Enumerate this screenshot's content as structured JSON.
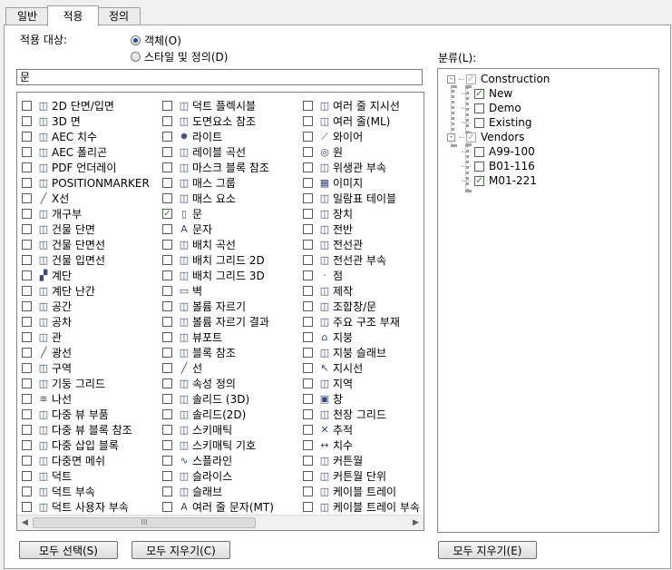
{
  "tabs": [
    {
      "label": "일반",
      "active": false
    },
    {
      "label": "적용",
      "active": true
    },
    {
      "label": "정의",
      "active": false
    }
  ],
  "apply_to": {
    "label": "적용 대상:",
    "options": [
      {
        "label": "객체(O)",
        "selected": true
      },
      {
        "label": "스타일 및 정의(D)",
        "selected": false
      }
    ]
  },
  "filter": {
    "value": "문"
  },
  "category_label": "분류(L):",
  "object_list": {
    "columns": [
      [
        {
          "label": "2D 단면/입면",
          "checked": false,
          "icon": "section-elevation-icon"
        },
        {
          "label": "3D 면",
          "checked": false,
          "icon": "3d-face-icon"
        },
        {
          "label": "AEC 치수",
          "checked": false,
          "icon": "aec-dimension-icon"
        },
        {
          "label": "AEC 폴리곤",
          "checked": false,
          "icon": "aec-polygon-icon"
        },
        {
          "label": "PDF 언더레이",
          "checked": false,
          "icon": "pdf-underlay-icon"
        },
        {
          "label": "POSITIONMARKER",
          "checked": false,
          "icon": "position-marker-icon"
        },
        {
          "label": "X선",
          "checked": false,
          "icon": "xline-icon"
        },
        {
          "label": "개구부",
          "checked": false,
          "icon": "opening-icon"
        },
        {
          "label": "건물 단면",
          "checked": false,
          "icon": "building-section-icon"
        },
        {
          "label": "건물 단면선",
          "checked": false,
          "icon": "building-section-line-icon"
        },
        {
          "label": "건물 입면선",
          "checked": false,
          "icon": "building-elevation-line-icon"
        },
        {
          "label": "계단",
          "checked": false,
          "icon": "stair-icon"
        },
        {
          "label": "계단 난간",
          "checked": false,
          "icon": "railing-icon"
        },
        {
          "label": "공간",
          "checked": false,
          "icon": "space-icon"
        },
        {
          "label": "공차",
          "checked": false,
          "icon": "tolerance-icon"
        },
        {
          "label": "관",
          "checked": false,
          "icon": "pipe-icon"
        },
        {
          "label": "광선",
          "checked": false,
          "icon": "ray-icon"
        },
        {
          "label": "구역",
          "checked": false,
          "icon": "zone-icon"
        },
        {
          "label": "기둥 그리드",
          "checked": false,
          "icon": "column-grid-icon"
        },
        {
          "label": "나선",
          "checked": false,
          "icon": "helix-icon"
        },
        {
          "label": "다중 뷰 부품",
          "checked": false,
          "icon": "multi-view-part-icon"
        },
        {
          "label": "다중 뷰 블록 참조",
          "checked": false,
          "icon": "multi-view-block-ref-icon"
        },
        {
          "label": "다중 삽입 블록",
          "checked": false,
          "icon": "minsert-block-icon"
        },
        {
          "label": "다중면 메쉬",
          "checked": false,
          "icon": "polyface-mesh-icon"
        },
        {
          "label": "덕트",
          "checked": false,
          "icon": "duct-icon"
        },
        {
          "label": "덕트 부속",
          "checked": false,
          "icon": "duct-fitting-icon"
        },
        {
          "label": "덕트 사용자 부속",
          "checked": false,
          "icon": "duct-custom-fitting-icon"
        }
      ],
      [
        {
          "label": "덕트 플렉시블",
          "checked": false,
          "icon": "duct-flex-icon"
        },
        {
          "label": "도면요소 참조",
          "checked": false,
          "icon": "element-ref-icon"
        },
        {
          "label": "라이트",
          "checked": false,
          "icon": "light-icon"
        },
        {
          "label": "레이블 곡선",
          "checked": false,
          "icon": "label-curve-icon"
        },
        {
          "label": "마스크 블록 참조",
          "checked": false,
          "icon": "mask-block-ref-icon"
        },
        {
          "label": "매스 그룹",
          "checked": false,
          "icon": "mass-group-icon"
        },
        {
          "label": "매스 요소",
          "checked": false,
          "icon": "mass-element-icon"
        },
        {
          "label": "문",
          "checked": true,
          "icon": "door-icon"
        },
        {
          "label": "문자",
          "checked": false,
          "icon": "text-icon"
        },
        {
          "label": "배치 곡선",
          "checked": false,
          "icon": "layout-curve-icon"
        },
        {
          "label": "배치 그리드 2D",
          "checked": false,
          "icon": "layout-grid-2d-icon"
        },
        {
          "label": "배치 그리드 3D",
          "checked": false,
          "icon": "layout-grid-3d-icon"
        },
        {
          "label": "벽",
          "checked": false,
          "icon": "wall-icon"
        },
        {
          "label": "볼륨 자르기",
          "checked": false,
          "icon": "volume-clip-icon"
        },
        {
          "label": "볼륨 자르기 결과",
          "checked": false,
          "icon": "volume-clip-result-icon"
        },
        {
          "label": "뷰포트",
          "checked": false,
          "icon": "viewport-icon"
        },
        {
          "label": "블록 참조",
          "checked": false,
          "icon": "block-ref-icon"
        },
        {
          "label": "선",
          "checked": false,
          "icon": "line-icon"
        },
        {
          "label": "속성 정의",
          "checked": false,
          "icon": "attribute-def-icon"
        },
        {
          "label": "솔리드 (3D)",
          "checked": false,
          "icon": "solid-3d-icon"
        },
        {
          "label": "솔리드(2D)",
          "checked": false,
          "icon": "solid-2d-icon"
        },
        {
          "label": "스키매틱",
          "checked": false,
          "icon": "schematic-icon"
        },
        {
          "label": "스키매틱 기호",
          "checked": false,
          "icon": "schematic-symbol-icon"
        },
        {
          "label": "스플라인",
          "checked": false,
          "icon": "spline-icon"
        },
        {
          "label": "슬라이스",
          "checked": false,
          "icon": "slice-icon"
        },
        {
          "label": "슬래브",
          "checked": false,
          "icon": "slab-icon"
        },
        {
          "label": "여러 줄 문자(MT)",
          "checked": false,
          "icon": "mtext-icon"
        }
      ],
      [
        {
          "label": "여러 줄 지시선",
          "checked": false,
          "icon": "multileader-icon"
        },
        {
          "label": "여러 줄(ML)",
          "checked": false,
          "icon": "mline-icon"
        },
        {
          "label": "와이어",
          "checked": false,
          "icon": "wire-icon"
        },
        {
          "label": "원",
          "checked": false,
          "icon": "circle-icon"
        },
        {
          "label": "위생관 부속",
          "checked": false,
          "icon": "plumbing-fitting-icon"
        },
        {
          "label": "이미지",
          "checked": false,
          "icon": "image-icon"
        },
        {
          "label": "일람표 테이블",
          "checked": false,
          "icon": "schedule-table-icon"
        },
        {
          "label": "장치",
          "checked": false,
          "icon": "device-icon"
        },
        {
          "label": "전반",
          "checked": false,
          "icon": "panel-icon"
        },
        {
          "label": "전선관",
          "checked": false,
          "icon": "conduit-icon"
        },
        {
          "label": "전선관 부속",
          "checked": false,
          "icon": "conduit-fitting-icon"
        },
        {
          "label": "점",
          "checked": false,
          "icon": "point-icon"
        },
        {
          "label": "제작",
          "checked": false,
          "icon": "fabrication-icon"
        },
        {
          "label": "조합창/문",
          "checked": false,
          "icon": "door-window-assembly-icon"
        },
        {
          "label": "주요 구조 부재",
          "checked": false,
          "icon": "structural-member-icon"
        },
        {
          "label": "지붕",
          "checked": false,
          "icon": "roof-icon"
        },
        {
          "label": "지붕 슬래브",
          "checked": false,
          "icon": "roof-slab-icon"
        },
        {
          "label": "지시선",
          "checked": false,
          "icon": "leader-icon"
        },
        {
          "label": "지역",
          "checked": false,
          "icon": "region-icon"
        },
        {
          "label": "창",
          "checked": false,
          "icon": "window-icon"
        },
        {
          "label": "천장 그리드",
          "checked": false,
          "icon": "ceiling-grid-icon"
        },
        {
          "label": "추적",
          "checked": false,
          "icon": "trace-icon"
        },
        {
          "label": "치수",
          "checked": false,
          "icon": "dimension-icon"
        },
        {
          "label": "커튼월",
          "checked": false,
          "icon": "curtain-wall-icon"
        },
        {
          "label": "커튼월 단위",
          "checked": false,
          "icon": "curtain-wall-unit-icon"
        },
        {
          "label": "케이블 트레이",
          "checked": false,
          "icon": "cable-tray-icon"
        },
        {
          "label": "케이블 트레이 부속",
          "checked": false,
          "icon": "cable-tray-fitting-icon"
        }
      ]
    ],
    "scroll_thumb_grip": "III"
  },
  "tree": {
    "nodes": [
      {
        "label": "Construction",
        "level": 0,
        "expander": "-",
        "checked": true,
        "grey": true
      },
      {
        "label": "New",
        "level": 1,
        "checked": true,
        "grey": false
      },
      {
        "label": "Demo",
        "level": 1,
        "checked": false,
        "grey": false
      },
      {
        "label": "Existing",
        "level": 1,
        "checked": false,
        "grey": false
      },
      {
        "label": "Vendors",
        "level": 0,
        "expander": "-",
        "checked": true,
        "grey": true
      },
      {
        "label": "A99-100",
        "level": 1,
        "checked": false,
        "grey": false
      },
      {
        "label": "B01-116",
        "level": 1,
        "checked": false,
        "grey": false
      },
      {
        "label": "M01-221",
        "level": 1,
        "checked": true,
        "grey": false
      }
    ]
  },
  "buttons": {
    "select_all": "모두 선택(S)",
    "clear_all": "모두 지우기(C)",
    "clear_all_e": "모두 지우기(E)"
  },
  "check_glyph": "✓",
  "colors": {
    "accent": "#1f4f8f",
    "check": "#1a8c1a"
  }
}
